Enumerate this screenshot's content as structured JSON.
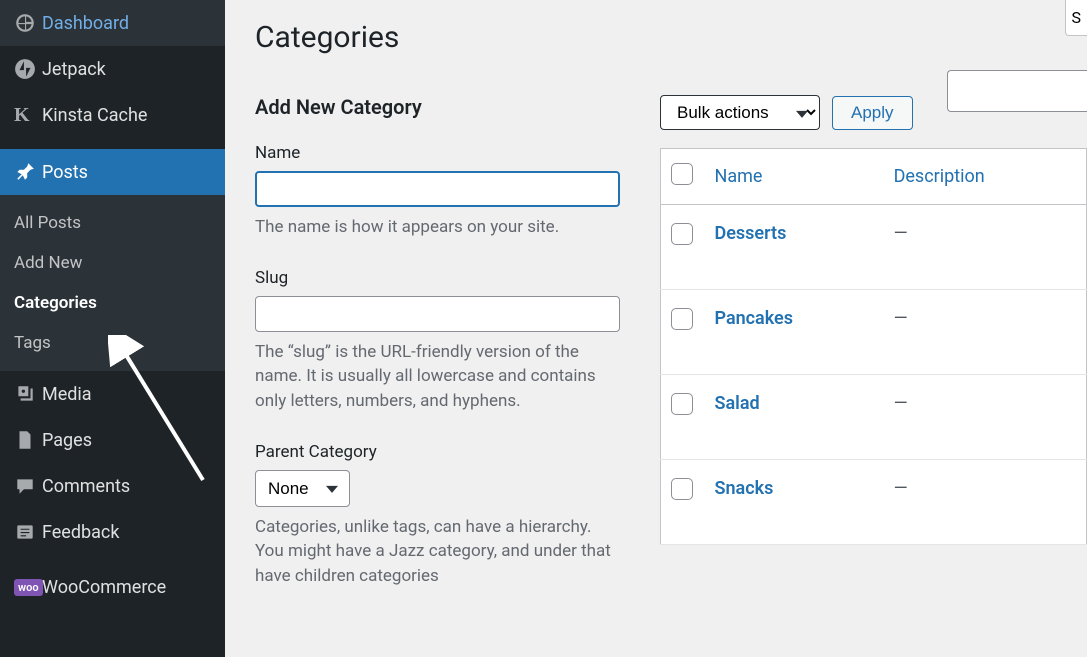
{
  "sidebar": {
    "items": [
      {
        "label": "Dashboard"
      },
      {
        "label": "Jetpack"
      },
      {
        "label": "Kinsta Cache"
      },
      {
        "label": "Posts"
      },
      {
        "label": "Media"
      },
      {
        "label": "Pages"
      },
      {
        "label": "Comments"
      },
      {
        "label": "Feedback"
      },
      {
        "label": "WooCommerce"
      }
    ],
    "submenu": [
      {
        "label": "All Posts"
      },
      {
        "label": "Add New"
      },
      {
        "label": "Categories"
      },
      {
        "label": "Tags"
      }
    ]
  },
  "page": {
    "title": "Categories"
  },
  "form": {
    "heading": "Add New Category",
    "name_label": "Name",
    "name_help": "The name is how it appears on your site.",
    "slug_label": "Slug",
    "slug_help": "The “slug” is the URL-friendly version of the name. It is usually all lowercase and contains only letters, numbers, and hyphens.",
    "parent_label": "Parent Category",
    "parent_value": "None",
    "parent_help": "Categories, unlike tags, can have a hierarchy. You might have a Jazz category, and under that have children categories"
  },
  "table": {
    "bulk_label": "Bulk actions",
    "apply_label": "Apply",
    "headers": {
      "name": "Name",
      "description": "Description"
    },
    "rows": [
      {
        "name": "Desserts",
        "description": "—"
      },
      {
        "name": "Pancakes",
        "description": "—"
      },
      {
        "name": "Salad",
        "description": "—"
      },
      {
        "name": "Snacks",
        "description": "—"
      }
    ]
  },
  "woo_badge": "woo"
}
